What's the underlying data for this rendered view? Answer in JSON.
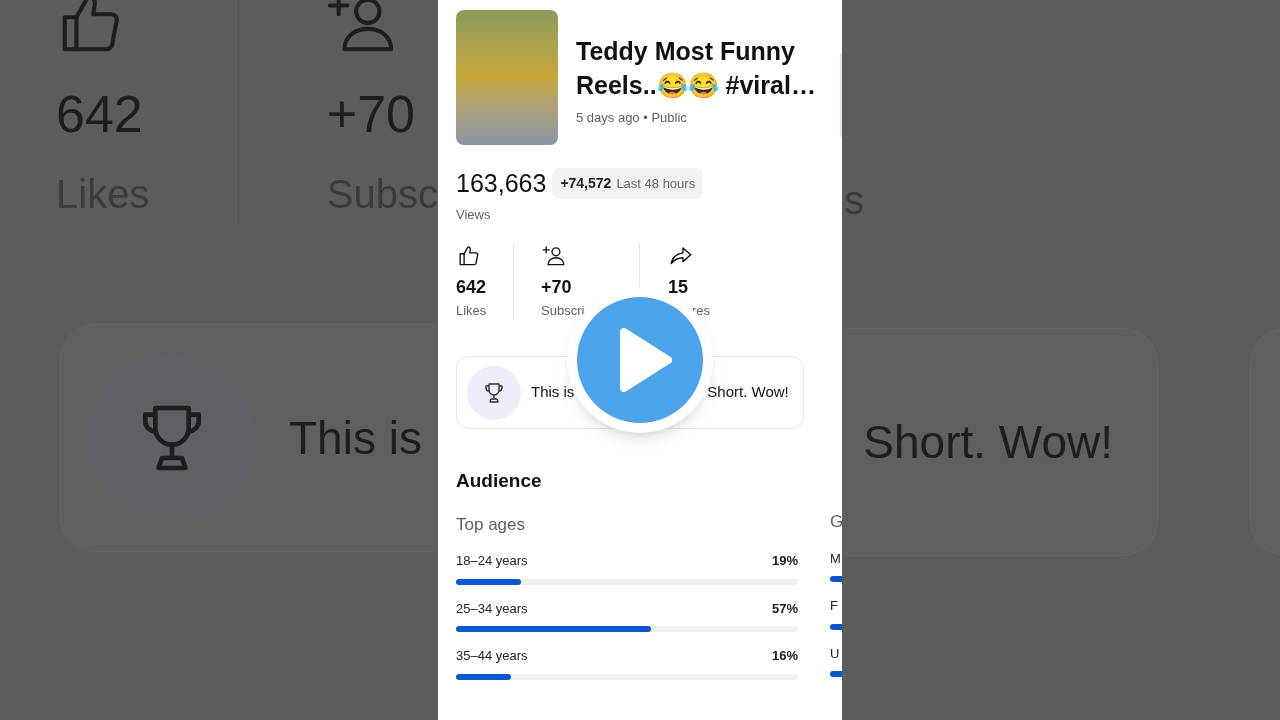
{
  "video": {
    "title": "Teddy Most Funny Reels..😂😂 #viral…",
    "meta": "5 days ago • Public"
  },
  "views": {
    "value": "163,663",
    "delta": "+74,572",
    "period": "Last 48 hours",
    "label": "Views"
  },
  "stats": [
    {
      "kind": "like",
      "value": "642",
      "label": "Likes"
    },
    {
      "kind": "subscriber",
      "value": "+70",
      "label": "Subscri"
    },
    {
      "kind": "share",
      "value": "15",
      "label": "res"
    }
  ],
  "achievement": {
    "text_start": "This is",
    "text_end": "Short. Wow!"
  },
  "audience": {
    "title": "Audience",
    "top_ages": {
      "title": "Top ages",
      "rows": [
        {
          "label": "18–24 years",
          "percent": "19%",
          "level": 0.19
        },
        {
          "label": "25–34 years",
          "percent": "57%",
          "level": 0.57
        },
        {
          "label": "35–44 years",
          "percent": "16%",
          "level": 0.16
        }
      ]
    },
    "next_column": {
      "title": "G",
      "rows": [
        "M",
        "F",
        "U"
      ]
    }
  },
  "backdrop": {
    "left": {
      "likes_value": "642",
      "likes_label": "Likes",
      "subs_value": "+70",
      "subs_label": "Subsc",
      "achievement": "This is"
    },
    "right": {
      "shares_label": "s",
      "achievement": "Short. Wow!"
    }
  }
}
